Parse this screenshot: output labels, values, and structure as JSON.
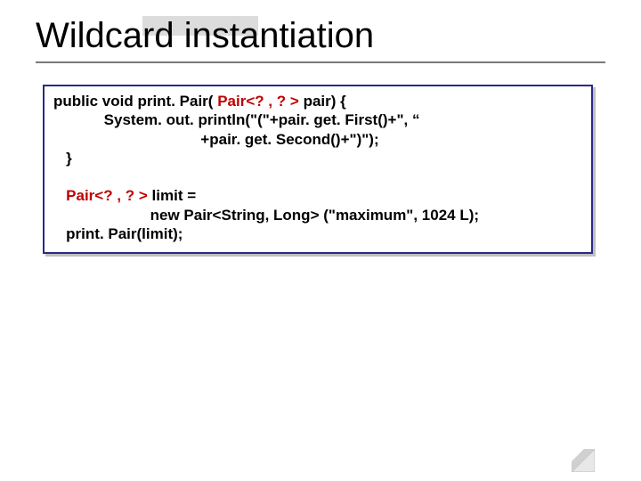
{
  "title": "Wildcard instantiation",
  "code": {
    "l1a": "public void print. Pair( ",
    "l1b": "Pair<? , ? >",
    "l1c": " pair) {",
    "l2": "            System. out. println(\"(\"+pair. get. First()+\", “",
    "l3": "                                   +pair. get. Second()+\")\");",
    "l4": "   }",
    "blank": " ",
    "l5a": "   Pair<? , ? >",
    "l5b": " limit =",
    "l6": "                       new Pair<String, Long> (\"maximum\", 1024 L);",
    "l7": "   print. Pair(limit);"
  }
}
